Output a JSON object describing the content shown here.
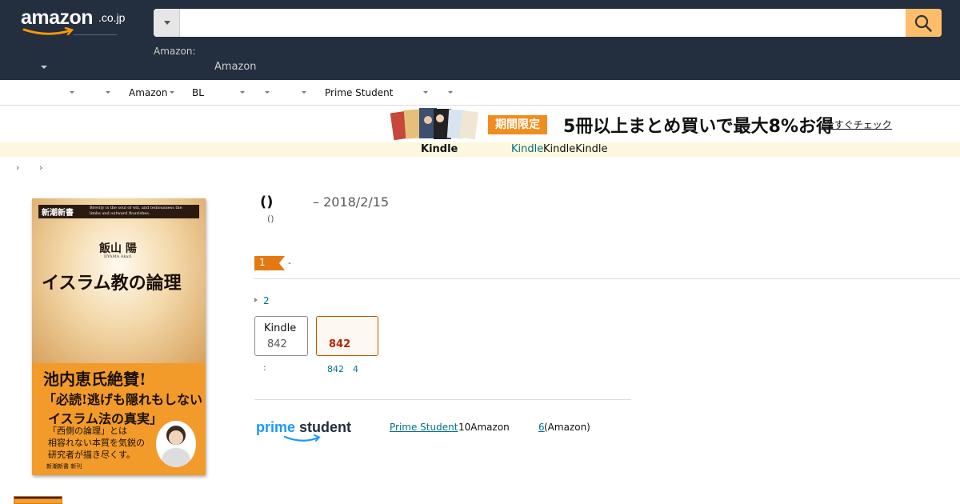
{
  "header": {
    "logo_text": "amazon",
    "logo_tld": ".co.jp",
    "search_placeholder": "",
    "address_label": "Amazon:",
    "address_value": "Amazon"
  },
  "subnav": {
    "items": [
      "Amazon",
      "BL",
      "Prime Student"
    ]
  },
  "promo": {
    "tag": "期間限定",
    "headline": "5冊以上まとめ買いで最大8%お得",
    "link": "›今すぐチェック"
  },
  "kindle_strip": {
    "label": "Kindle",
    "link": "Kindle",
    "rest": "KindleKindle"
  },
  "breadcrumb": {
    "sep1": "›",
    "sep2": "›"
  },
  "cover": {
    "publisher": "新潮新書",
    "tagline": "Brevity is the soul of wit, and tediousness the limbs and outward flourishes.",
    "author": "飯山 陽",
    "author_romaji": "IIYAMA Akari",
    "title": "イスラム教の論理",
    "praise": "池内恵氏絶賛!",
    "quote1": "「必読!逃げも隠れもしない",
    "quote2": "イスラム法の真実」",
    "desc1": "「西側の論理」とは",
    "desc2": "相容れない本質を気鋭の",
    "desc3": "研究者が描き尽くす。",
    "footer": "新潮新書 新刊"
  },
  "product": {
    "title": "()",
    "date": "– 2018/2/15",
    "author": "()",
    "rank_badge": "1",
    "rank_dash": "-",
    "formats_toggle": "2",
    "formats": [
      {
        "name": "Kindle",
        "price": "842",
        "sub": ":"
      },
      {
        "name": "",
        "price": "842",
        "sub": "842　4"
      }
    ]
  },
  "prime_student": {
    "logo_a": "prime",
    "logo_b": "student",
    "link": "Prime Student",
    "link_rest": "10Amazon",
    "num": "6",
    "num_rest": "(Amazon)"
  },
  "colors": {
    "header_bg": "#232f3e",
    "search_button": "#febd69",
    "link": "#007185",
    "price_red": "#b12704",
    "promo_orange": "#f08d1e",
    "prime_blue": "#1a98ff"
  }
}
